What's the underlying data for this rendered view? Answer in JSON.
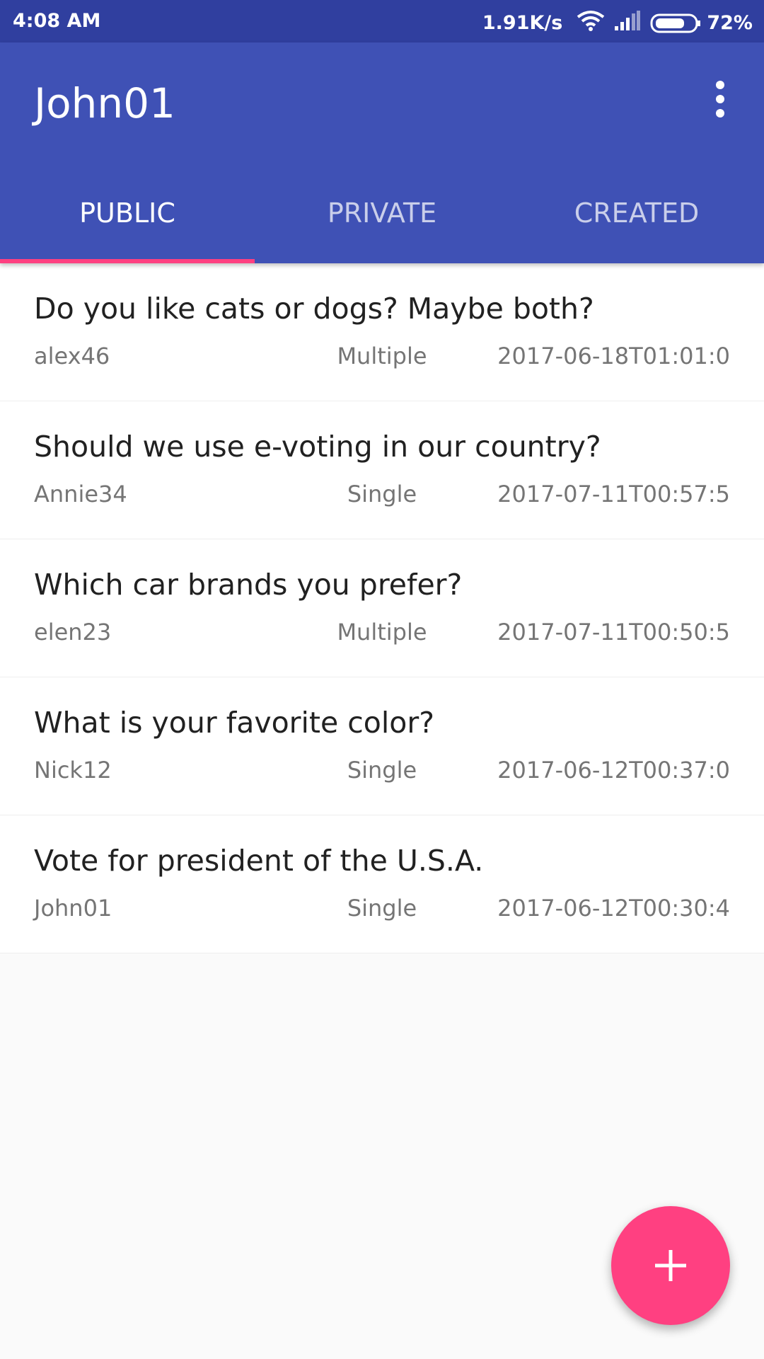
{
  "status_bar": {
    "time": "4:08 AM",
    "network_speed": "1.91K/s",
    "battery_percent": "72%",
    "icons": [
      "wifi-icon",
      "signal-icon",
      "battery-icon"
    ]
  },
  "app_bar": {
    "title": "John01",
    "overflow_icon": "more-vert-icon"
  },
  "tabs": [
    {
      "label": "PUBLIC",
      "active": true
    },
    {
      "label": "PRIVATE",
      "active": false
    },
    {
      "label": "CREATED",
      "active": false
    }
  ],
  "polls": [
    {
      "question": "Do you like cats or dogs? Maybe both?",
      "author": "alex46",
      "type": "Multiple",
      "date": "2017-06-18T01:01:0"
    },
    {
      "question": "Should we use e-voting in our country?",
      "author": "Annie34",
      "type": "Single",
      "date": "2017-07-11T00:57:5"
    },
    {
      "question": "Which car brands you prefer?",
      "author": "elen23",
      "type": "Multiple",
      "date": "2017-07-11T00:50:5"
    },
    {
      "question": "What is your favorite color?",
      "author": "Nick12",
      "type": "Single",
      "date": "2017-06-12T00:37:0"
    },
    {
      "question": "Vote for president of the U.S.A.",
      "author": "John01",
      "type": "Single",
      "date": "2017-06-12T00:30:4"
    }
  ],
  "fab": {
    "icon": "add-icon"
  },
  "colors": {
    "primary": "#3f51b5",
    "primary_dark": "#303f9f",
    "accent": "#ff4081"
  }
}
